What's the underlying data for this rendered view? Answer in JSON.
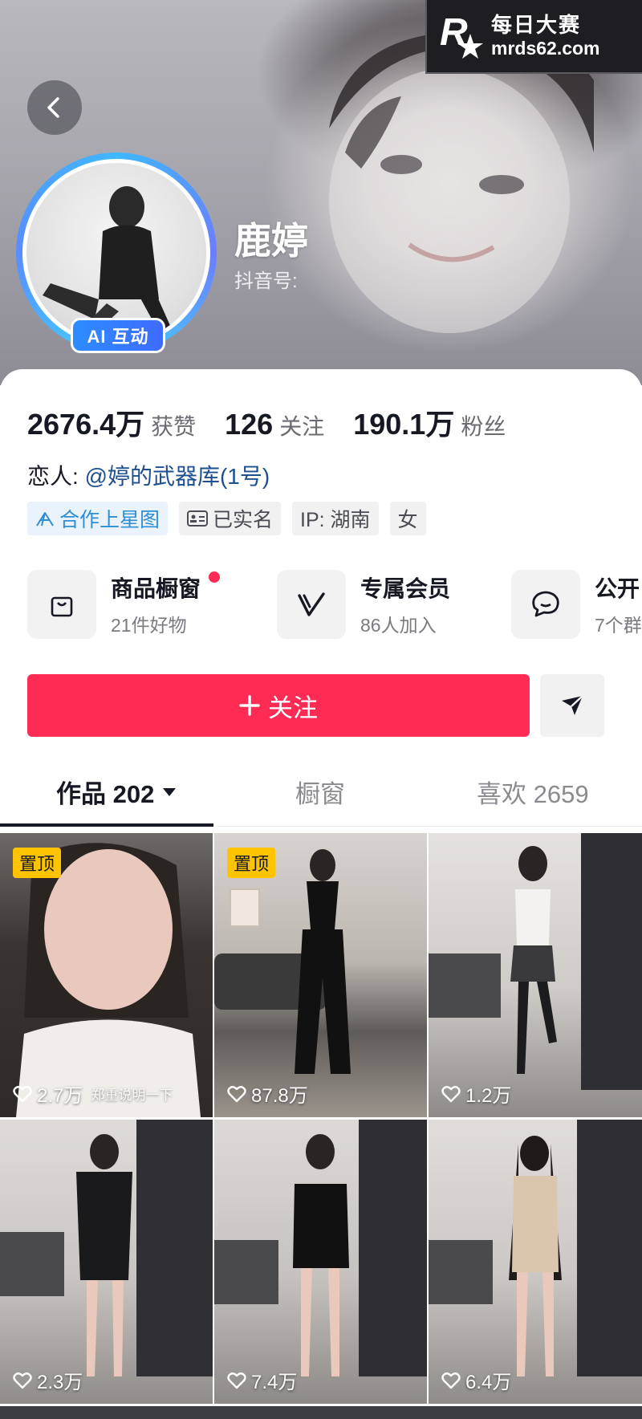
{
  "watermark": {
    "logo_letter": "R",
    "brand_cn": "每日大赛",
    "url": "mrds62.com"
  },
  "profile": {
    "name": "鹿婷",
    "douyin_id_label": "抖音号:",
    "ai_badge": "AI 互动"
  },
  "stats": [
    {
      "value": "2676.4万",
      "label": "获赞"
    },
    {
      "value": "126",
      "label": "关注"
    },
    {
      "value": "190.1万",
      "label": "粉丝"
    }
  ],
  "lover": {
    "prefix": "恋人:",
    "handle": "@婷的武器库(1号)"
  },
  "tags": [
    {
      "label": "合作上星图",
      "icon": "star-map-icon"
    },
    {
      "label": "已实名",
      "icon": "id-card-icon"
    },
    {
      "label": "IP: 湖南"
    },
    {
      "label": "女"
    }
  ],
  "services": [
    {
      "title": "商品橱窗",
      "subtitle": "21件好物",
      "icon": "shopping-bag-icon",
      "has_dot": true
    },
    {
      "title": "专属会员",
      "subtitle": "86人加入",
      "icon": "member-v-icon",
      "has_dot": false
    },
    {
      "title": "公开",
      "subtitle": "7个群",
      "icon": "group-chat-icon",
      "has_dot": false
    }
  ],
  "actions": {
    "follow_label": "关注"
  },
  "tabs": [
    {
      "label": "作品 202",
      "active": true
    },
    {
      "label": "橱窗",
      "active": false
    },
    {
      "label": "喜欢 2659",
      "active": false
    }
  ],
  "videos": [
    {
      "likes": "2.7万",
      "pinned": true,
      "pin_label": "置顶",
      "caption": "郑重说明一下"
    },
    {
      "likes": "87.8万",
      "pinned": true,
      "pin_label": "置顶"
    },
    {
      "likes": "1.2万",
      "pinned": false
    },
    {
      "likes": "2.3万",
      "pinned": false
    },
    {
      "likes": "7.4万",
      "pinned": false
    },
    {
      "likes": "6.4万",
      "pinned": false
    }
  ],
  "colors": {
    "accent": "#fe2c55",
    "link": "#1e4f8f",
    "badge_blue": "#2d8cff",
    "pin_yellow": "#ffc300"
  }
}
